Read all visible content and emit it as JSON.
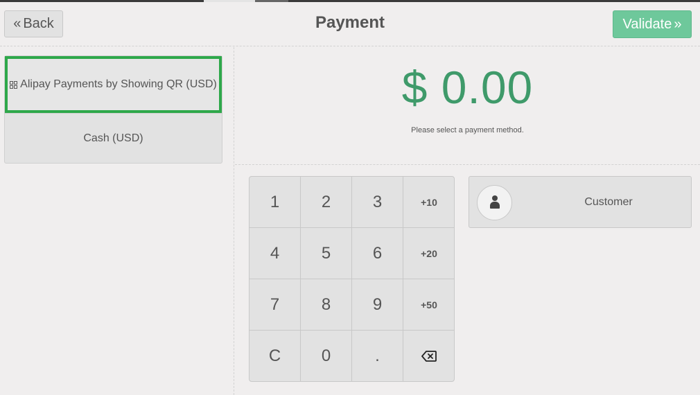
{
  "header": {
    "back_label": "Back",
    "title": "Payment",
    "validate_label": "Validate"
  },
  "payment_methods": [
    {
      "label": "Alipay Payments by Showing QR (USD)",
      "icon": "qr-icon",
      "selected": true
    },
    {
      "label": "Cash (USD)",
      "selected": false
    }
  ],
  "amount": {
    "value": "$ 0.00",
    "hint": "Please select a payment method."
  },
  "numpad": {
    "keys": [
      "1",
      "2",
      "3",
      "+10",
      "4",
      "5",
      "6",
      "+20",
      "7",
      "8",
      "9",
      "+50",
      "C",
      "0",
      ".",
      "backspace-icon"
    ]
  },
  "customer": {
    "label": "Customer",
    "icon": "user-icon"
  },
  "colors": {
    "accent_green": "#3f9a6a",
    "validate_green": "#6ec89b",
    "selection_border": "#2ea84a"
  }
}
